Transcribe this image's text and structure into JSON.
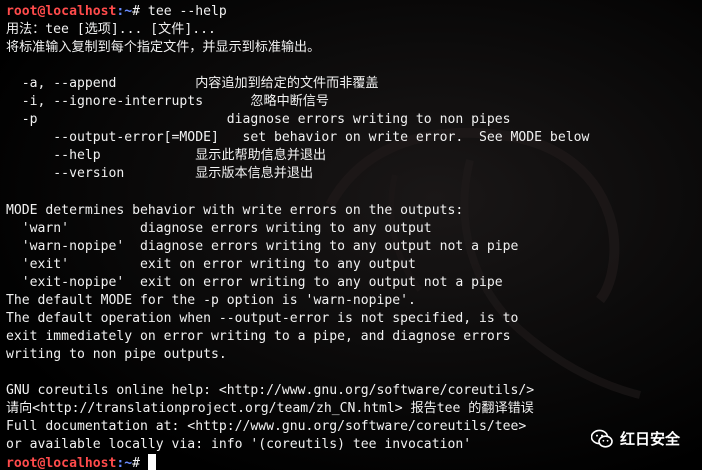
{
  "prompt": {
    "user_host": "root@localhost",
    "path": ":~",
    "symbol": "#"
  },
  "command": " tee --help",
  "output": [
    "用法：tee [选项]... [文件]...",
    "将标准输入复制到每个指定文件，并显示到标准输出。",
    "",
    "  -a, --append          内容追加到给定的文件而非覆盖",
    "  -i, --ignore-interrupts      忽略中断信号",
    "  -p                        diagnose errors writing to non pipes",
    "      --output-error[=MODE]   set behavior on write error.  See MODE below",
    "      --help            显示此帮助信息并退出",
    "      --version         显示版本信息并退出",
    "",
    "MODE determines behavior with write errors on the outputs:",
    "  'warn'         diagnose errors writing to any output",
    "  'warn-nopipe'  diagnose errors writing to any output not a pipe",
    "  'exit'         exit on error writing to any output",
    "  'exit-nopipe'  exit on error writing to any output not a pipe",
    "The default MODE for the -p option is 'warn-nopipe'.",
    "The default operation when --output-error is not specified, is to",
    "exit immediately on error writing to a pipe, and diagnose errors",
    "writing to non pipe outputs.",
    "",
    "GNU coreutils online help: <http://www.gnu.org/software/coreutils/>",
    "请向<http://translationproject.org/team/zh_CN.html> 报告tee 的翻译错误",
    "Full documentation at: <http://www.gnu.org/software/coreutils/tee>",
    "or available locally via: info '(coreutils) tee invocation'"
  ],
  "watermark": {
    "text": "红日安全",
    "icon": "wechat-icon"
  },
  "colors": {
    "background": "#000000",
    "text": "#f2f2f2",
    "user": "#ff4b4b",
    "path": "#6a8cff"
  }
}
